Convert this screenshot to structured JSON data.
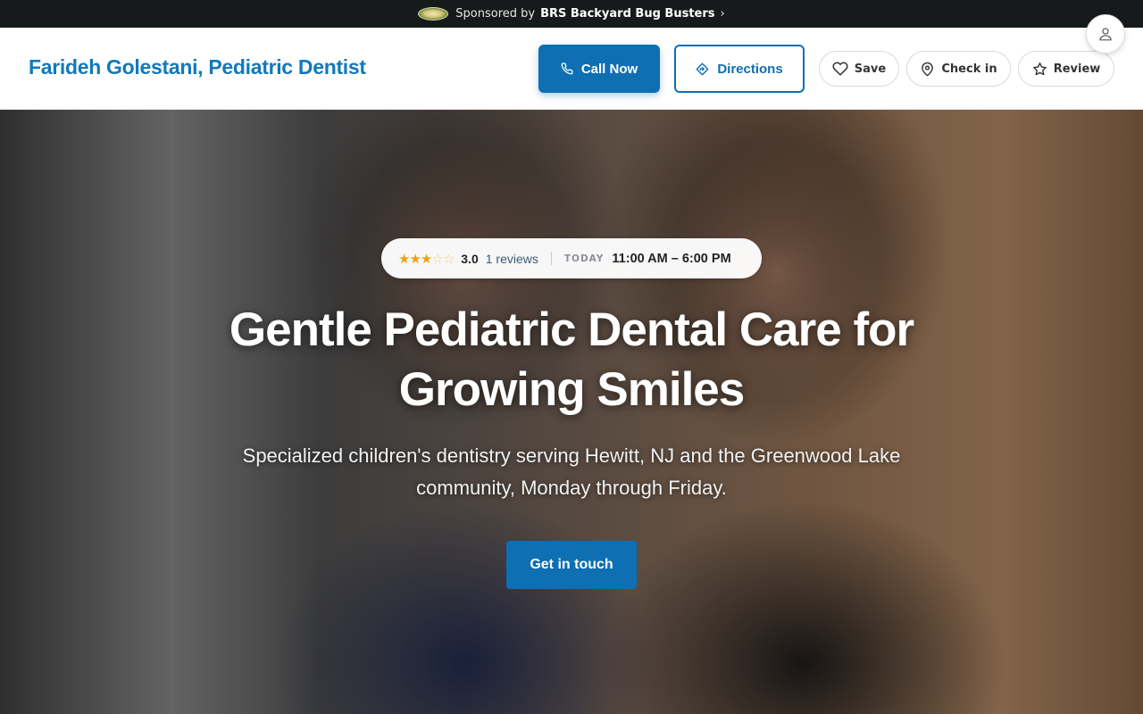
{
  "sponsor": {
    "prefix": "Sponsored by",
    "name": "BRS Backyard Bug Busters",
    "chevron": "›"
  },
  "header": {
    "brand": "Farideh Golestani, Pediatric Dentist",
    "call_label": "Call Now",
    "directions_label": "Directions",
    "save_label": "Save",
    "checkin_label": "Check in",
    "review_label": "Review",
    "icons": {
      "call": "phone-icon",
      "directions": "directions-icon",
      "save": "heart-icon",
      "checkin": "map-pin-icon",
      "review": "star-icon",
      "account": "user-icon"
    }
  },
  "hero": {
    "rating": {
      "stars_filled": 3,
      "stars_total": 5,
      "value": "3.0",
      "reviews": "1 reviews",
      "day_label": "TODAY",
      "hours": "11:00 AM – 6:00 PM"
    },
    "title": "Gentle Pediatric Dental Care for Growing Smiles",
    "subtitle": "Specialized children's dentistry serving Hewitt, NJ and the Greenwood Lake community, Monday through Friday.",
    "cta_label": "Get in touch"
  },
  "colors": {
    "primary": "#0e6fb2",
    "brand_text": "#1279b8",
    "sponsor_bg": "#161a1a",
    "star": "#e8a317"
  }
}
